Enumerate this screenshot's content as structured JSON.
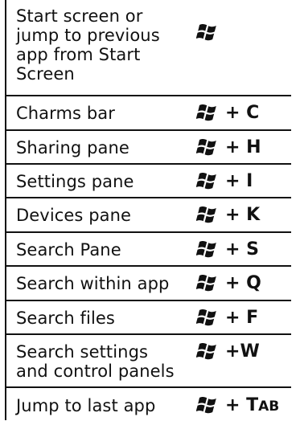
{
  "rows": [
    {
      "description": "Start screen or jump to previous app from Start Screen",
      "plus": "",
      "key": "",
      "key_rest": ""
    },
    {
      "description": "Charms bar",
      "plus": "+ ",
      "key": "C",
      "key_rest": ""
    },
    {
      "description": "Sharing pane",
      "plus": "+ ",
      "key": "H",
      "key_rest": ""
    },
    {
      "description": "Settings pane",
      "plus": "+ ",
      "key": "I",
      "key_rest": ""
    },
    {
      "description": "Devices pane",
      "plus": "+ ",
      "key": "K",
      "key_rest": ""
    },
    {
      "description": "Search Pane",
      "plus": "+ ",
      "key": "S",
      "key_rest": ""
    },
    {
      "description": "Search within app",
      "plus": "+ ",
      "key": "Q",
      "key_rest": ""
    },
    {
      "description": "Search files",
      "plus": "+ ",
      "key": "F",
      "key_rest": ""
    },
    {
      "description": "Search settings and control panels",
      "plus": "+",
      "key": "W",
      "key_rest": ""
    },
    {
      "description": "Jump to last app",
      "plus": "+ ",
      "key": "T",
      "key_rest": "AB"
    }
  ],
  "icon": "windows-logo-icon",
  "colors": {
    "text": "#111111",
    "rule": "#111111",
    "background": "#ffffff"
  }
}
